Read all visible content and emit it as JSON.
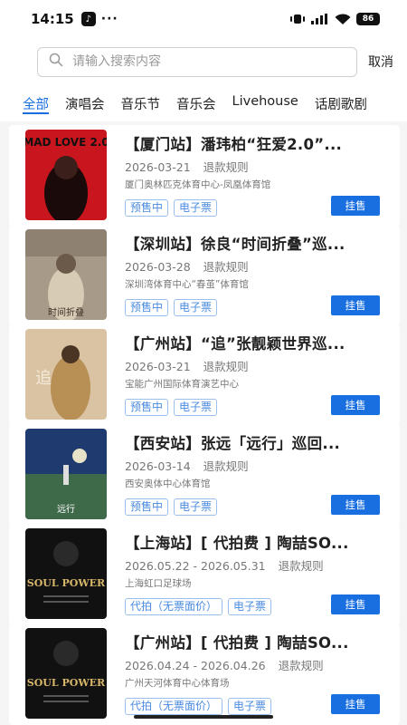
{
  "status_bar": {
    "time": "14:15",
    "dots": "···",
    "battery": "86"
  },
  "search": {
    "placeholder": "请输入搜索内容",
    "cancel_label": "取消"
  },
  "tabs": [
    {
      "label": "全部"
    },
    {
      "label": "演唱会"
    },
    {
      "label": "音乐节"
    },
    {
      "label": "音乐会"
    },
    {
      "label": "Livehouse"
    },
    {
      "label": "话剧歌剧"
    }
  ],
  "active_tab": "全部",
  "colors": {
    "accent": "#1a6fe0",
    "tag_text": "#4a8be0"
  },
  "events": [
    {
      "title": "【厦门站】潘玮柏“狂爱2.0”...",
      "date": "2026-03-21",
      "refund": "退款规则",
      "venue": "厦门奥林匹克体育中心-凤凰体育馆",
      "tags": [
        "预售中",
        "电子票"
      ],
      "action": "挂售",
      "poster_text": "MAD LOVE 2.0"
    },
    {
      "title": "【深圳站】徐良“时间折叠”巡...",
      "date": "2026-03-28",
      "refund": "退款规则",
      "venue": "深圳湾体育中心“春茧”体育馆",
      "tags": [
        "预售中",
        "电子票"
      ],
      "action": "挂售",
      "poster_text": "时间折叠"
    },
    {
      "title": "【广州站】“追”张靓颖世界巡...",
      "date": "2026-03-21",
      "refund": "退款规则",
      "venue": "宝能广州国际体育演艺中心",
      "tags": [
        "预售中",
        "电子票"
      ],
      "action": "挂售",
      "poster_text": "追"
    },
    {
      "title": "【西安站】张远「远行」巡回...",
      "date": "2026-03-14",
      "refund": "退款规则",
      "venue": "西安奥体中心体育馆",
      "tags": [
        "预售中",
        "电子票"
      ],
      "action": "挂售",
      "poster_text": "远行"
    },
    {
      "title": "【上海站】[ 代拍费 ] 陶喆SO...",
      "date": "2026.05.22 - 2026.05.31",
      "refund": "退款规则",
      "venue": "上海虹口足球场",
      "tags": [
        "代拍（无票面价）",
        "电子票"
      ],
      "action": "挂售",
      "poster_text": "SOUL POWER"
    },
    {
      "title": "【广州站】[ 代拍费 ] 陶喆SO...",
      "date": "2026.04.24 - 2026.04.26",
      "refund": "退款规则",
      "venue": "广州天河体育中心体育场",
      "tags": [
        "代拍（无票面价）",
        "电子票"
      ],
      "action": "挂售",
      "poster_text": "SOUL POWER"
    }
  ]
}
